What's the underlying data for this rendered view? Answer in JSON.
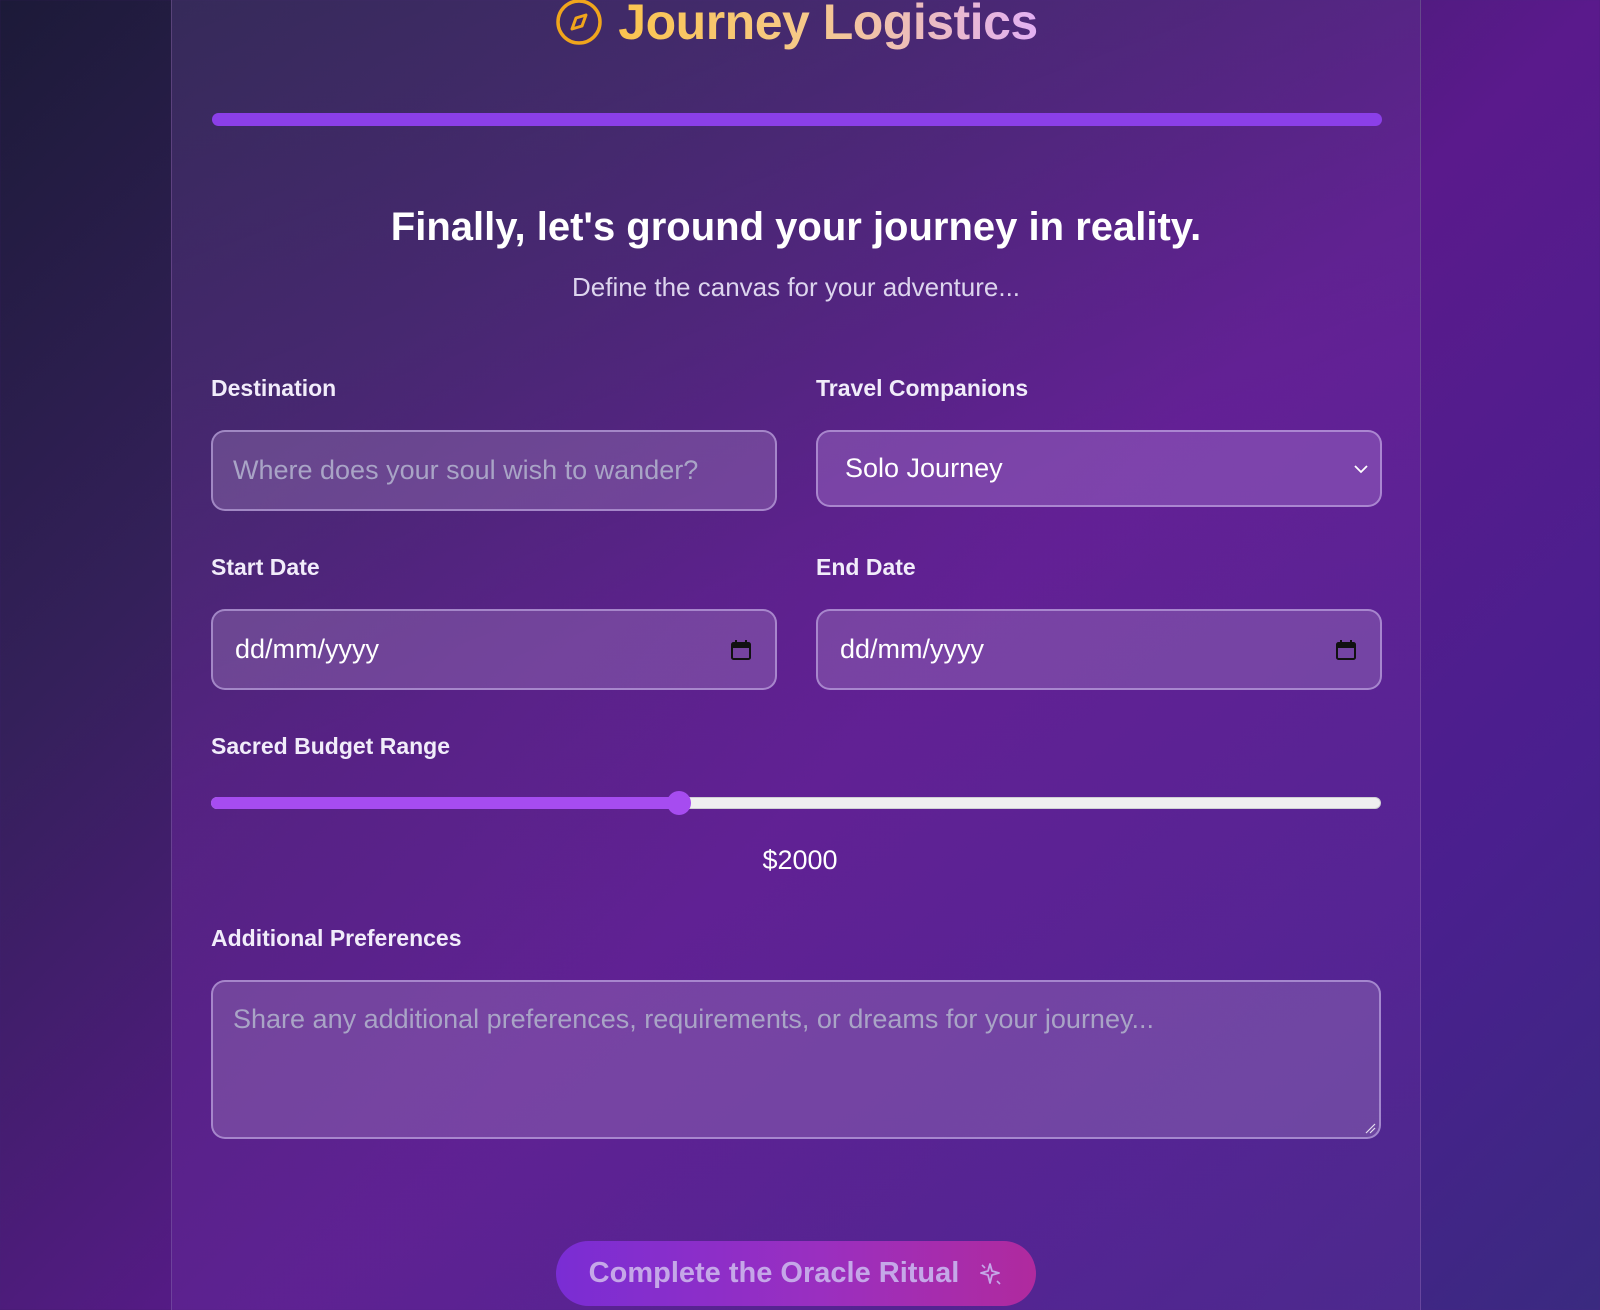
{
  "brand": {
    "title": "Journey Logistics",
    "icon": "compass-icon"
  },
  "progress": {
    "value": 1.0
  },
  "step": {
    "heading": "Finally, let's ground your journey in reality.",
    "subheading": "Define the canvas for your adventure..."
  },
  "form": {
    "destination": {
      "label": "Destination",
      "placeholder": "Where does your soul wish to wander?",
      "value": ""
    },
    "companions": {
      "label": "Travel Companions",
      "value": "Solo Journey"
    },
    "start_date": {
      "label": "Start Date",
      "value": "dd/mm/yyyy"
    },
    "end_date": {
      "label": "End Date",
      "value": "dd/mm/yyyy"
    },
    "budget": {
      "label": "Sacred Budget Range",
      "display": "$2000",
      "fraction": 0.4
    },
    "preferences": {
      "label": "Additional Preferences",
      "placeholder": "Share any additional preferences, requirements, or dreams for your journey..."
    }
  },
  "cta": {
    "label": "Complete the Oracle Ritual",
    "icon": "sparkle-icon"
  },
  "colors": {
    "accent": "#a64cf0",
    "brand_gold": "#fbc44e",
    "background": "#5a1a8c"
  }
}
